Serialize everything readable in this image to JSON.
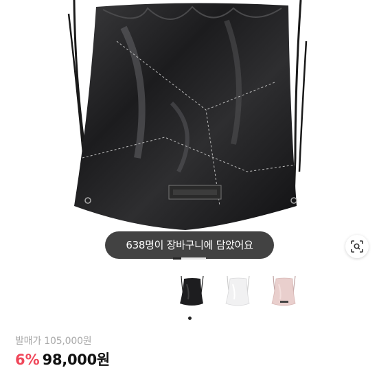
{
  "product": {
    "cart_message": "638명이 장바구니에 담았어요",
    "list_price_label": "발매가 105,000원",
    "discount_label": "6%",
    "sale_price_label": "98,000원",
    "image_index": 0.25,
    "thumbnails": [
      {
        "color": "black",
        "selected": true
      },
      {
        "color": "white",
        "selected": false
      },
      {
        "color": "pink",
        "selected": false
      }
    ]
  },
  "colors": {
    "discount": "#f0475a",
    "price": "#111111",
    "muted": "#a8a8a8",
    "toast": "#282828"
  },
  "icons": {
    "lens": "lens-search-icon"
  }
}
